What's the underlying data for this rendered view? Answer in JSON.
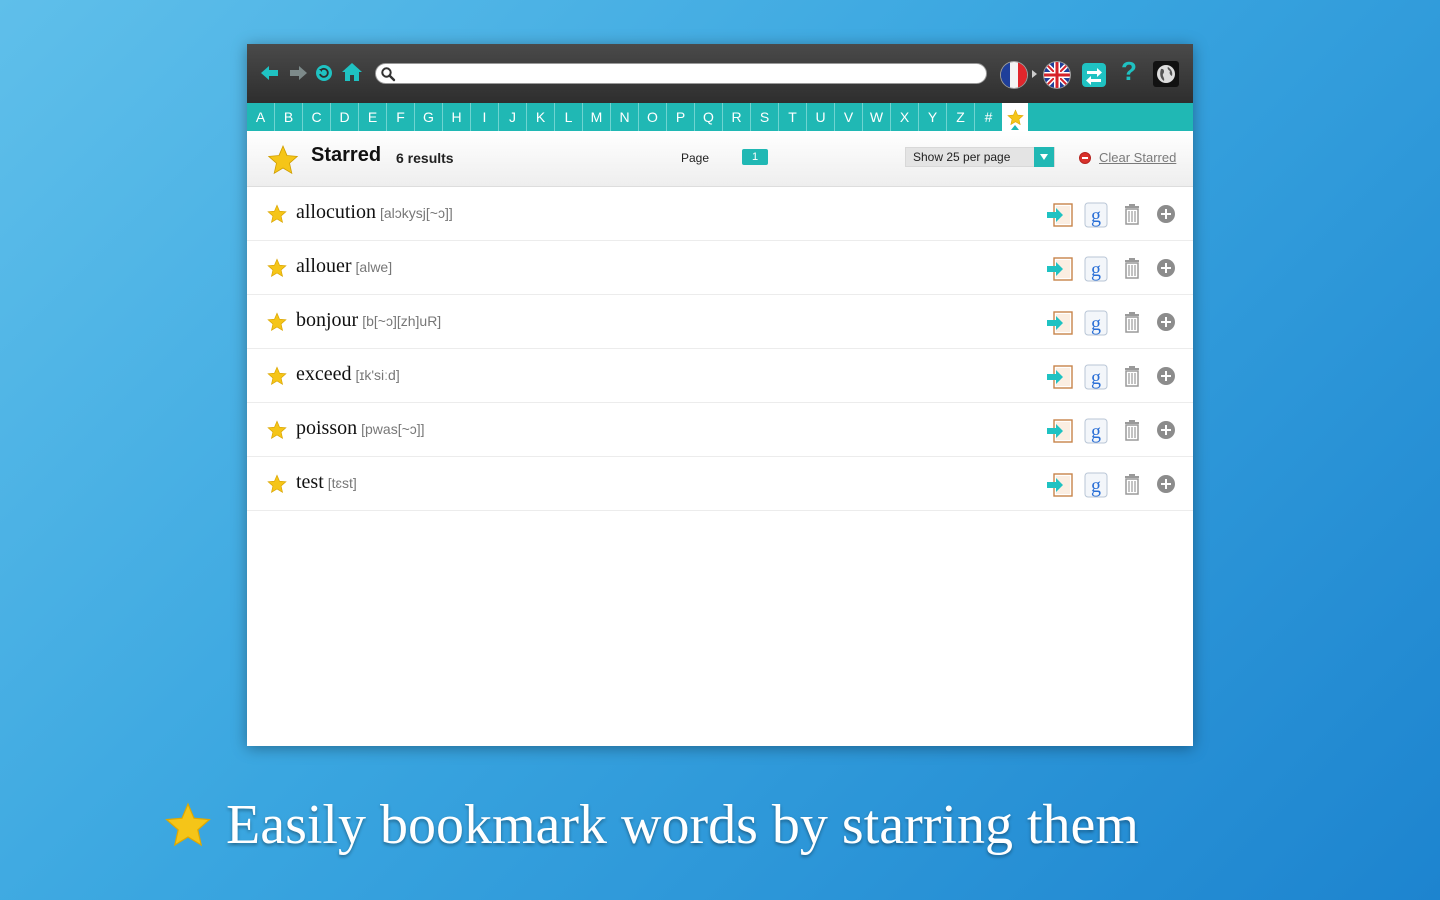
{
  "toolbar": {
    "back_icon": "arrow-left-icon",
    "forward_icon": "arrow-right-icon",
    "reload_icon": "reload-icon",
    "home_icon": "home-icon",
    "search": {
      "value": "",
      "placeholder": ""
    },
    "source_language_flag": "french-flag-icon",
    "target_language_flag": "uk-flag-icon",
    "swap_icon": "swap-icon",
    "help_label": "?",
    "globe_icon": "globe-icon"
  },
  "alphabet": [
    "A",
    "B",
    "C",
    "D",
    "E",
    "F",
    "G",
    "H",
    "I",
    "J",
    "K",
    "L",
    "M",
    "N",
    "O",
    "P",
    "Q",
    "R",
    "S",
    "T",
    "U",
    "V",
    "W",
    "X",
    "Y",
    "Z",
    "#"
  ],
  "header": {
    "title": "Starred",
    "count": "6 results",
    "page_label": "Page",
    "page_number": "1",
    "per_page": "Show 25 per page",
    "clear_label": "Clear Starred"
  },
  "words": [
    {
      "word": "allocution",
      "phonetic": "[alɔkysj[~ɔ]]"
    },
    {
      "word": "allouer",
      "phonetic": "[alwe]"
    },
    {
      "word": "bonjour",
      "phonetic": "[b[~ɔ][zh]uR]"
    },
    {
      "word": "exceed",
      "phonetic": "[ɪk'siːd]"
    },
    {
      "word": "poisson",
      "phonetic": "[pwas[~ɔ]]"
    },
    {
      "word": "test",
      "phonetic": "[tɛst]"
    }
  ],
  "row_action_icons": [
    "open-entry-icon",
    "google-icon",
    "trash-icon",
    "plus-icon"
  ],
  "caption": "Easily bookmark words by starring them",
  "colors": {
    "accent": "#20b8b4",
    "star": "#f5c518",
    "toolbar": "#3a3a3a"
  }
}
